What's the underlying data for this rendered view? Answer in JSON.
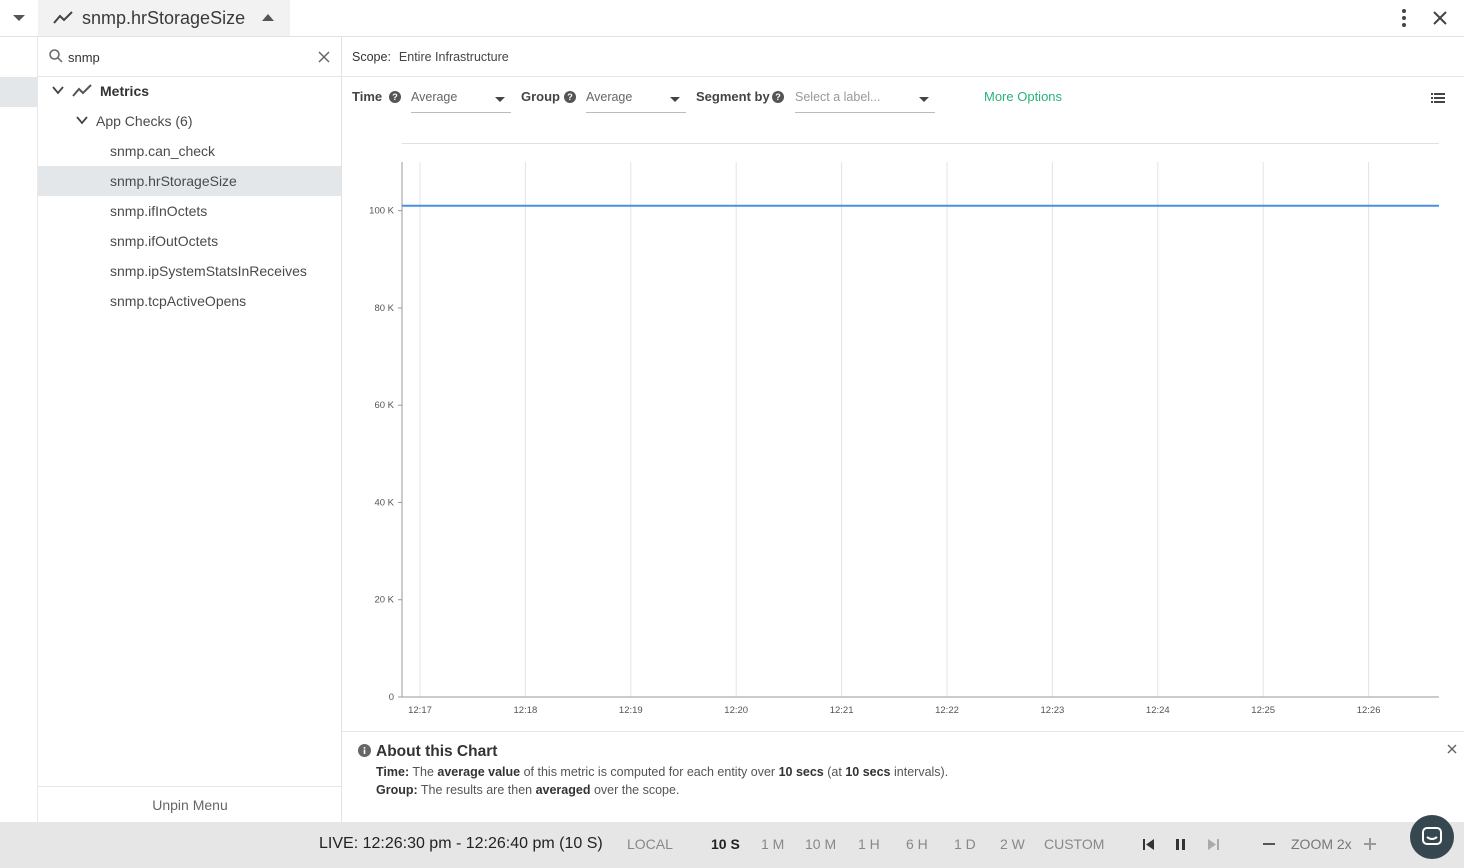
{
  "header": {
    "title": "snmp.hrStorageSize"
  },
  "search": {
    "value": "snmp"
  },
  "tree": {
    "root_label": "Metrics",
    "group_label": "App Checks (6)",
    "items": [
      {
        "label": "snmp.can_check"
      },
      {
        "label": "snmp.hrStorageSize"
      },
      {
        "label": "snmp.ifInOctets"
      },
      {
        "label": "snmp.ifOutOctets"
      },
      {
        "label": "snmp.ipSystemStatsInReceives"
      },
      {
        "label": "snmp.tcpActiveOpens"
      }
    ],
    "selected_index": 1
  },
  "sidebar": {
    "unpin_label": "Unpin Menu"
  },
  "scope": {
    "label": "Scope:",
    "value": "Entire Infrastructure"
  },
  "controls": {
    "time_label": "Time",
    "time_value": "Average",
    "group_label": "Group",
    "group_value": "Average",
    "segment_label": "Segment by",
    "segment_placeholder": "Select a label...",
    "more_options": "More Options",
    "help_glyph": "?"
  },
  "chart_data": {
    "type": "line",
    "x": [
      "12:17",
      "12:18",
      "12:19",
      "12:20",
      "12:21",
      "12:22",
      "12:23",
      "12:24",
      "12:25",
      "12:26"
    ],
    "series": [
      {
        "values": [
          101000,
          101000,
          101000,
          101000,
          101000,
          101000,
          101000,
          101000,
          101000,
          101000
        ],
        "color": "#4a90e2"
      }
    ],
    "ylim": [
      0,
      110000
    ],
    "yticks": [
      0,
      20000,
      40000,
      60000,
      80000,
      100000
    ],
    "ytick_labels": [
      "0",
      "20 K",
      "40 K",
      "60 K",
      "80 K",
      "100 K"
    ],
    "grid": "vertical",
    "title": "",
    "xlabel": "",
    "ylabel": ""
  },
  "about": {
    "title": "About this Chart",
    "time_prefix": "Time:",
    "time_t1": "The",
    "time_b1": "average value",
    "time_t2": "of this metric is computed for each entity over",
    "time_b2": "10 secs",
    "time_t3": "(at",
    "time_b3": "10 secs",
    "time_t4": "intervals).",
    "group_prefix": "Group:",
    "group_t1": "The results are then",
    "group_b1": "averaged",
    "group_t2": "over the scope."
  },
  "bottom": {
    "live": "LIVE: 12:26:30 pm - 12:26:40 pm (10 S)",
    "local": "LOCAL",
    "ranges": [
      "10 S",
      "1 M",
      "10 M",
      "1 H",
      "6 H",
      "1 D",
      "2 W",
      "CUSTOM"
    ],
    "active_range": "10 S",
    "zoom": "ZOOM 2x"
  },
  "colors": {
    "accent_green": "#2ab27b",
    "line_blue": "#4a90e2",
    "selected_bg": "#e3e7ea"
  }
}
